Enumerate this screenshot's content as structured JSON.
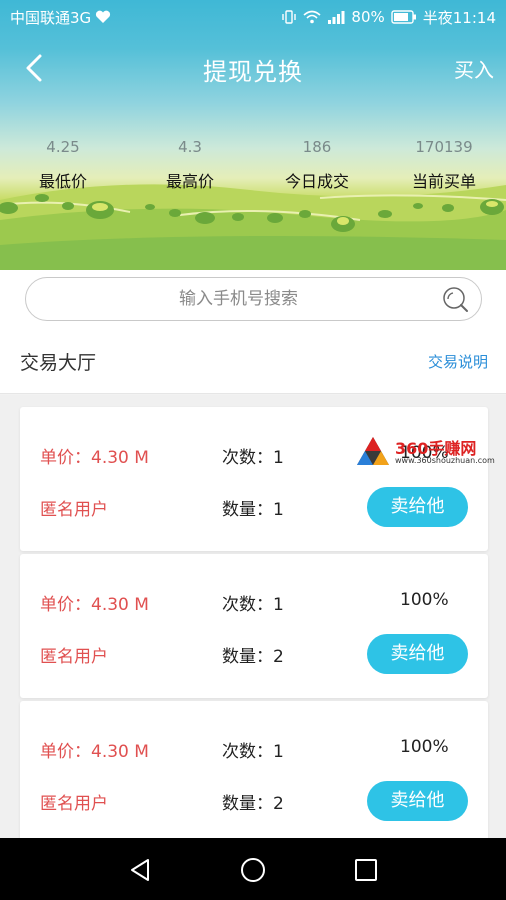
{
  "status_bar": {
    "carrier": "中国联通3G",
    "battery": "80%",
    "time": "半夜11:14"
  },
  "header": {
    "title": "提现兑换",
    "action_label": "买入"
  },
  "stats": [
    {
      "value": "4.25",
      "label": "最低价"
    },
    {
      "value": "4.3",
      "label": "最高价"
    },
    {
      "value": "186",
      "label": "今日成交"
    },
    {
      "value": "170139",
      "label": "当前买单"
    }
  ],
  "search": {
    "placeholder": "输入手机号搜索",
    "value": ""
  },
  "section": {
    "title": "交易大厅",
    "link": "交易说明"
  },
  "orders": [
    {
      "price": "单价：4.30 M",
      "user": "匿名用户",
      "times": "次数：1",
      "qty": "数量：1",
      "pct": "100%",
      "button": "卖给他"
    },
    {
      "price": "单价：4.30 M",
      "user": "匿名用户",
      "times": "次数：1",
      "qty": "数量：2",
      "pct": "100%",
      "button": "卖给他"
    },
    {
      "price": "单价：4.30 M",
      "user": "匿名用户",
      "times": "次数：1",
      "qty": "数量：2",
      "pct": "100%",
      "button": "卖给他"
    }
  ],
  "watermark": {
    "text": "360手赚网",
    "url": "www.360shouzhuan.com"
  },
  "colors": {
    "accent": "#2ec3e6",
    "price_red": "#e05050",
    "link_blue": "#2a8ed8"
  }
}
